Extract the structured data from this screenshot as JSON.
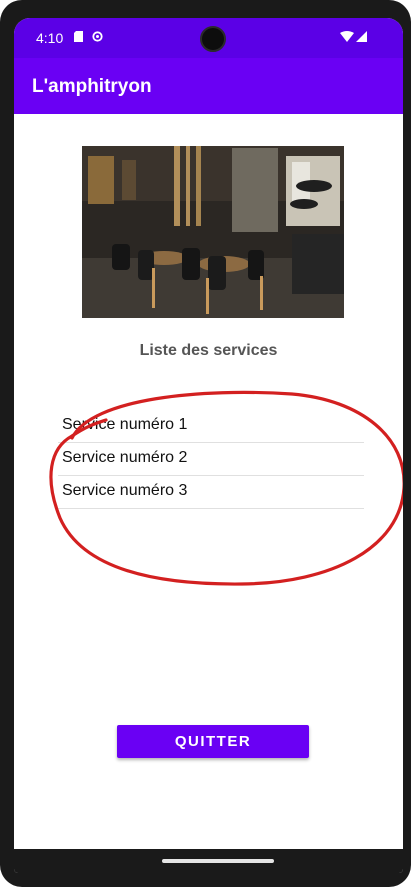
{
  "status_bar": {
    "time": "4:10",
    "left_icons": [
      "sd-card-icon",
      "sync-icon"
    ],
    "right_icons": [
      "wifi-icon",
      "signal-icon"
    ],
    "color": "#5b00e6"
  },
  "app_bar": {
    "title": "L'amphitryon",
    "color": "#6a00f4"
  },
  "hero_image": {
    "subject": "restaurant-interior"
  },
  "services": {
    "title": "Liste des services",
    "items": [
      {
        "label": "Service numéro 1"
      },
      {
        "label": "Service numéro 2"
      },
      {
        "label": "Service numéro 3"
      }
    ]
  },
  "annotation": {
    "color": "#d32020"
  },
  "actions": {
    "quit_label": "QUITTER",
    "color": "#6a00f4"
  }
}
